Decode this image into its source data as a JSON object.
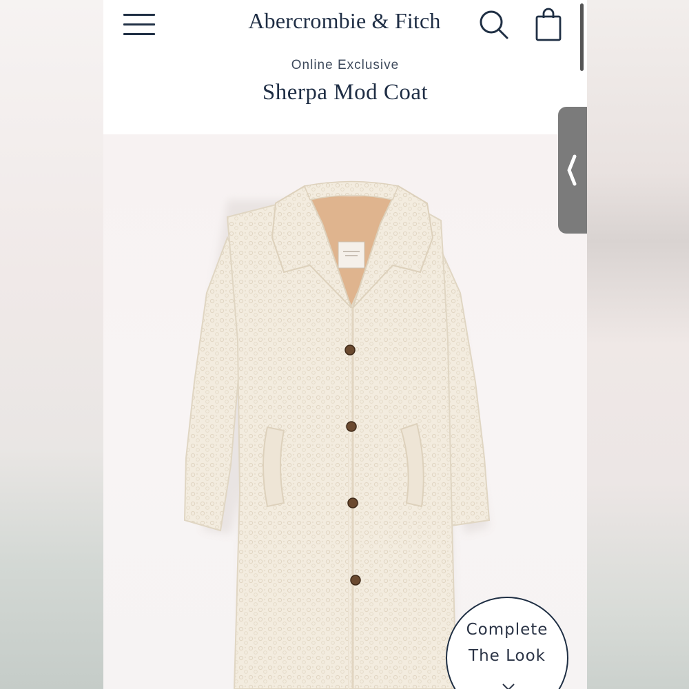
{
  "header": {
    "brand": "Abercrombie & Fitch",
    "menu_icon": "hamburger-menu-icon",
    "search_icon": "search-icon",
    "bag_icon": "shopping-bag-icon"
  },
  "product": {
    "eyebrow": "Online Exclusive",
    "title": "Sherpa Mod Coat",
    "image": "cream sherpa long coat with collar, tortoiseshell buttons and side pockets"
  },
  "complete_look": {
    "line1": "Complete",
    "line2": "The Look",
    "icon": "chevron-down-icon"
  },
  "side_tab": {
    "icon": "chevron-left-icon"
  },
  "colors": {
    "navy": "#1e2d44",
    "coat": "#f4ede0",
    "lining": "#dfb48e",
    "tab_gray": "#7b7b7b"
  }
}
